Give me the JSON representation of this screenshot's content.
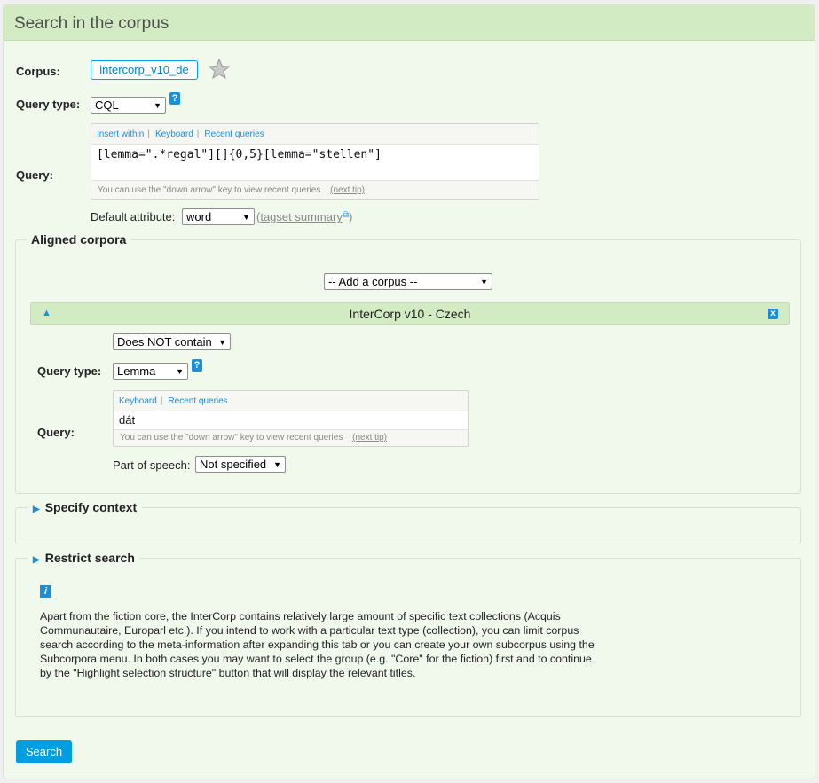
{
  "panel": {
    "title": "Search in the corpus"
  },
  "corpus": {
    "label": "Corpus:",
    "value": "intercorp_v10_de"
  },
  "main_query": {
    "type_label": "Query type:",
    "type_value": "CQL",
    "query_label": "Query:",
    "links": [
      "Insert within",
      "Keyboard",
      "Recent queries"
    ],
    "text": "[lemma=\".*regal\"][]{0,5}[lemma=\"stellen\"]",
    "hint": "You can use the \"down arrow\" key to view recent queries",
    "hint_link": "(next tip)",
    "default_attr_label": "Default attribute:",
    "default_attr_value": "word",
    "tagset_link": "tagset summary",
    "tagset_paren_open": "(",
    "tagset_paren_close": ")"
  },
  "aligned": {
    "legend": "Aligned corpora",
    "add_corpus": "-- Add a corpus --",
    "corpus_title": "InterCorp v10 - Czech",
    "contain_value": "Does NOT contain",
    "type_label": "Query type:",
    "type_value": "Lemma",
    "query_label": "Query:",
    "links": [
      "Keyboard",
      "Recent queries"
    ],
    "text": "dát",
    "hint": "You can use the \"down arrow\" key to view recent queries",
    "hint_link": "(next tip)",
    "pos_label": "Part of speech:",
    "pos_value": "Not specified"
  },
  "context": {
    "legend": "Specify context"
  },
  "restrict": {
    "legend": "Restrict search",
    "info": "Apart from the fiction core, the InterCorp contains relatively large amount of specific text collections (Acquis Communautaire, Europarl etc.). If you intend to work with a particular text type (collection), you can limit corpus search according to the meta-information after expanding this tab or you can create your own subcorpus using the Subcorpora menu. In both cases you may want to select the group (e.g. \"Core\" for the fiction) first and to continue by the \"Highlight selection structure\" button that will display the relevant titles."
  },
  "search_button": "Search",
  "icons": {
    "help": "question-icon",
    "star": "star-icon",
    "info": "info-icon",
    "collapse": "collapse-up-icon",
    "close": "close-icon",
    "external": "external-link-icon",
    "expand": "triangle-right-icon"
  },
  "colors": {
    "accent": "#1d8fd8",
    "header_bg": "#d3ebc3",
    "panel_bg": "#f1f8ec",
    "button": "#009ee0"
  }
}
